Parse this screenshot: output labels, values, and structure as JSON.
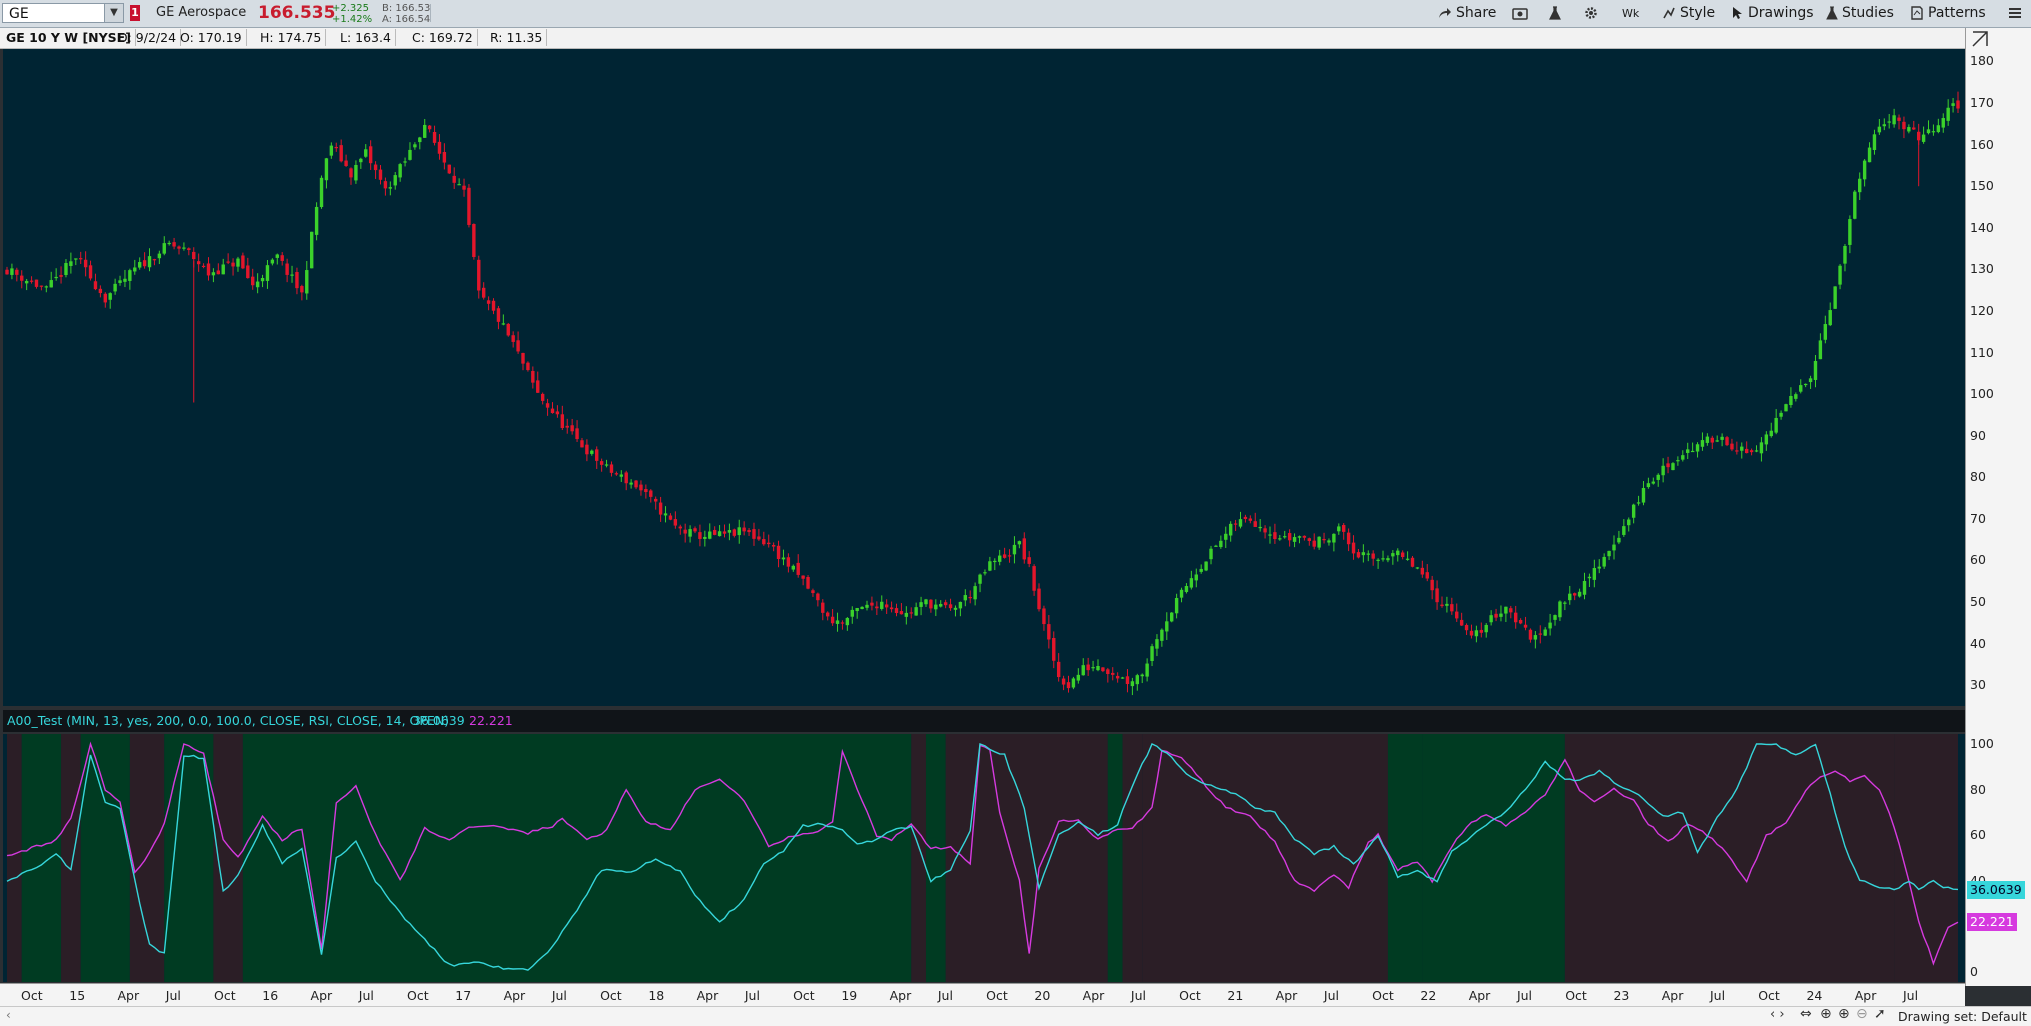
{
  "toolbar": {
    "symbol": "GE",
    "flag": "1",
    "company": "GE Aerospace",
    "last_price": "166.535",
    "change": "+2.325",
    "change_pct": "+1.42%",
    "bid": "B: 166.53",
    "ask": "A: 166.54",
    "buttons": {
      "share": "Share",
      "interval": "Wk",
      "style": "Style",
      "drawings": "Drawings",
      "studies": "Studies",
      "patterns": "Patterns"
    }
  },
  "info_bar": {
    "title": "GE 10 Y W [NYSE]",
    "date": "D: 9/2/24",
    "open": "O: 170.19",
    "high": "H: 174.75",
    "low": "L: 163.4",
    "close": "C: 169.72",
    "range": "R: 11.35"
  },
  "indicator": {
    "label": "A00_Test (MIN, 13, yes, 200, 0.0, 100.0, CLOSE, RSI, CLOSE, 14, OPEN)",
    "value_cyan": "36.0639",
    "value_magenta": "22.221"
  },
  "price_axis": [
    "180",
    "170",
    "160",
    "150",
    "140",
    "130",
    "120",
    "110",
    "100",
    "90",
    "80",
    "70",
    "60",
    "50",
    "40",
    "30"
  ],
  "indicator_axis": [
    "100",
    "80",
    "60",
    "40",
    "20",
    "0"
  ],
  "time_axis": [
    "Oct",
    "15",
    "Apr",
    "Jul",
    "Oct",
    "16",
    "Apr",
    "Jul",
    "Oct",
    "17",
    "Apr",
    "Jul",
    "Oct",
    "18",
    "Apr",
    "Jul",
    "Oct",
    "19",
    "Apr",
    "Jul",
    "Oct",
    "20",
    "Apr",
    "Jul",
    "Oct",
    "21",
    "Apr",
    "Jul",
    "Oct",
    "22",
    "Apr",
    "Jul",
    "Oct",
    "23",
    "Apr",
    "Jul",
    "Oct",
    "24",
    "Apr",
    "Jul"
  ],
  "status": {
    "drawing_set": "Drawing set: Default"
  },
  "colors": {
    "up": "#3bd12b",
    "down": "#e3162b",
    "cyan": "#36d6db",
    "magenta": "#d63adf",
    "background": "#002433",
    "zone_green": "#003b22",
    "zone_dark": "#2b1e26"
  },
  "chart_data": {
    "type": "candlestick",
    "ylim": [
      25,
      183
    ],
    "price_path": [
      [
        0,
        130
      ],
      [
        8,
        125
      ],
      [
        14,
        133
      ],
      [
        20,
        123
      ],
      [
        26,
        130
      ],
      [
        33,
        136
      ],
      [
        37,
        134
      ],
      [
        41,
        129
      ],
      [
        47,
        132
      ],
      [
        50,
        126
      ],
      [
        55,
        133
      ],
      [
        60,
        124
      ],
      [
        64,
        152
      ],
      [
        66,
        160
      ],
      [
        70,
        153
      ],
      [
        73,
        158
      ],
      [
        77,
        149
      ],
      [
        81,
        156
      ],
      [
        85,
        165
      ],
      [
        88,
        158
      ],
      [
        93,
        148
      ],
      [
        96,
        124
      ],
      [
        100,
        118
      ],
      [
        103,
        112
      ],
      [
        108,
        100
      ],
      [
        115,
        90
      ],
      [
        122,
        82
      ],
      [
        128,
        78
      ],
      [
        133,
        72
      ],
      [
        136,
        68
      ],
      [
        140,
        66
      ],
      [
        145,
        66
      ],
      [
        150,
        67
      ],
      [
        155,
        64
      ],
      [
        162,
        55
      ],
      [
        165,
        50
      ],
      [
        167,
        46
      ],
      [
        170,
        45
      ],
      [
        173,
        48
      ],
      [
        178,
        50
      ],
      [
        183,
        47
      ],
      [
        187,
        50
      ],
      [
        192,
        48
      ],
      [
        196,
        52
      ],
      [
        200,
        59
      ],
      [
        204,
        62
      ],
      [
        206,
        64
      ],
      [
        208,
        58
      ],
      [
        211,
        44
      ],
      [
        214,
        32
      ],
      [
        216,
        30
      ],
      [
        219,
        34
      ],
      [
        222,
        35
      ],
      [
        225,
        33
      ],
      [
        228,
        31
      ],
      [
        231,
        33
      ],
      [
        234,
        42
      ],
      [
        238,
        50
      ],
      [
        241,
        56
      ],
      [
        245,
        62
      ],
      [
        250,
        69
      ],
      [
        253,
        70
      ],
      [
        257,
        67
      ],
      [
        260,
        65
      ],
      [
        263,
        66
      ],
      [
        266,
        64
      ],
      [
        269,
        66
      ],
      [
        271,
        68
      ],
      [
        274,
        62
      ],
      [
        278,
        60
      ],
      [
        282,
        62
      ],
      [
        287,
        58
      ],
      [
        291,
        51
      ],
      [
        295,
        47
      ],
      [
        298,
        41
      ],
      [
        302,
        46
      ],
      [
        305,
        49
      ],
      [
        309,
        43
      ],
      [
        311,
        41
      ],
      [
        314,
        46
      ],
      [
        318,
        52
      ],
      [
        321,
        54
      ],
      [
        325,
        61
      ],
      [
        329,
        68
      ],
      [
        333,
        77
      ],
      [
        337,
        82
      ],
      [
        341,
        86
      ],
      [
        345,
        88
      ],
      [
        348,
        90
      ],
      [
        352,
        87
      ],
      [
        355,
        85
      ],
      [
        358,
        90
      ],
      [
        362,
        97
      ],
      [
        367,
        105
      ],
      [
        370,
        117
      ],
      [
        373,
        130
      ],
      [
        376,
        148
      ],
      [
        380,
        162
      ],
      [
        384,
        168
      ],
      [
        386,
        164
      ],
      [
        389,
        162
      ],
      [
        392,
        163
      ],
      [
        394,
        166
      ],
      [
        396,
        170
      ],
      [
        397,
        168
      ]
    ],
    "rsi_path": [
      [
        0,
        51
      ],
      [
        6,
        55
      ],
      [
        10,
        58
      ],
      [
        13,
        67
      ],
      [
        17,
        100
      ],
      [
        20,
        80
      ],
      [
        23,
        74
      ],
      [
        26,
        44
      ],
      [
        29,
        52
      ],
      [
        32,
        65
      ],
      [
        36,
        100
      ],
      [
        40,
        96
      ],
      [
        44,
        58
      ],
      [
        47,
        50
      ],
      [
        52,
        68
      ],
      [
        56,
        58
      ],
      [
        60,
        63
      ],
      [
        64,
        10
      ],
      [
        67,
        74
      ],
      [
        71,
        82
      ],
      [
        75,
        60
      ],
      [
        80,
        40
      ],
      [
        85,
        63
      ],
      [
        90,
        58
      ],
      [
        94,
        63
      ],
      [
        100,
        64
      ],
      [
        106,
        61
      ],
      [
        111,
        64
      ],
      [
        113,
        67
      ],
      [
        118,
        58
      ],
      [
        122,
        62
      ],
      [
        126,
        80
      ],
      [
        130,
        66
      ],
      [
        135,
        62
      ],
      [
        140,
        80
      ],
      [
        145,
        85
      ],
      [
        150,
        75
      ],
      [
        155,
        55
      ],
      [
        160,
        60
      ],
      [
        165,
        61
      ],
      [
        168,
        66
      ],
      [
        170,
        97
      ],
      [
        173,
        80
      ],
      [
        177,
        60
      ],
      [
        180,
        58
      ],
      [
        184,
        65
      ],
      [
        188,
        54
      ],
      [
        192,
        55
      ],
      [
        196,
        47
      ],
      [
        198,
        100
      ],
      [
        200,
        98
      ],
      [
        202,
        70
      ],
      [
        206,
        40
      ],
      [
        208,
        8
      ],
      [
        210,
        45
      ],
      [
        214,
        66
      ],
      [
        218,
        67
      ],
      [
        222,
        58
      ],
      [
        226,
        63
      ],
      [
        229,
        63
      ],
      [
        233,
        72
      ],
      [
        235,
        97
      ],
      [
        239,
        94
      ],
      [
        243,
        84
      ],
      [
        248,
        72
      ],
      [
        253,
        68
      ],
      [
        258,
        57
      ],
      [
        262,
        40
      ],
      [
        266,
        36
      ],
      [
        270,
        43
      ],
      [
        273,
        37
      ],
      [
        277,
        57
      ],
      [
        279,
        60
      ],
      [
        283,
        45
      ],
      [
        287,
        48
      ],
      [
        290,
        40
      ],
      [
        294,
        55
      ],
      [
        297,
        64
      ],
      [
        301,
        69
      ],
      [
        305,
        64
      ],
      [
        309,
        70
      ],
      [
        313,
        78
      ],
      [
        317,
        93
      ],
      [
        320,
        80
      ],
      [
        323,
        75
      ],
      [
        327,
        80
      ],
      [
        331,
        75
      ],
      [
        334,
        65
      ],
      [
        338,
        57
      ],
      [
        342,
        65
      ],
      [
        346,
        60
      ],
      [
        350,
        52
      ],
      [
        354,
        40
      ],
      [
        358,
        60
      ],
      [
        362,
        65
      ],
      [
        366,
        80
      ],
      [
        369,
        85
      ],
      [
        372,
        88
      ],
      [
        375,
        84
      ],
      [
        378,
        86
      ],
      [
        381,
        80
      ],
      [
        384,
        64
      ],
      [
        387,
        40
      ],
      [
        389,
        22
      ],
      [
        392,
        4
      ],
      [
        395,
        20
      ],
      [
        397,
        22
      ]
    ],
    "stoch_path": [
      [
        0,
        40
      ],
      [
        6,
        46
      ],
      [
        10,
        52
      ],
      [
        13,
        45
      ],
      [
        17,
        95
      ],
      [
        20,
        74
      ],
      [
        23,
        72
      ],
      [
        26,
        40
      ],
      [
        29,
        12
      ],
      [
        32,
        8
      ],
      [
        36,
        95
      ],
      [
        40,
        94
      ],
      [
        44,
        35
      ],
      [
        47,
        42
      ],
      [
        52,
        64
      ],
      [
        56,
        48
      ],
      [
        60,
        54
      ],
      [
        64,
        8
      ],
      [
        67,
        50
      ],
      [
        71,
        57
      ],
      [
        75,
        40
      ],
      [
        80,
        26
      ],
      [
        85,
        14
      ],
      [
        90,
        3
      ],
      [
        96,
        4
      ],
      [
        100,
        2
      ],
      [
        106,
        1
      ],
      [
        110,
        8
      ],
      [
        115,
        24
      ],
      [
        121,
        45
      ],
      [
        127,
        44
      ],
      [
        132,
        50
      ],
      [
        137,
        44
      ],
      [
        141,
        31
      ],
      [
        145,
        22
      ],
      [
        150,
        32
      ],
      [
        154,
        48
      ],
      [
        158,
        53
      ],
      [
        162,
        64
      ],
      [
        166,
        65
      ],
      [
        170,
        62
      ],
      [
        173,
        56
      ],
      [
        177,
        58
      ],
      [
        180,
        62
      ],
      [
        184,
        64
      ],
      [
        188,
        40
      ],
      [
        192,
        45
      ],
      [
        196,
        62
      ],
      [
        198,
        100
      ],
      [
        200,
        98
      ],
      [
        203,
        95
      ],
      [
        207,
        72
      ],
      [
        210,
        37
      ],
      [
        214,
        60
      ],
      [
        218,
        66
      ],
      [
        222,
        60
      ],
      [
        226,
        65
      ],
      [
        229,
        82
      ],
      [
        233,
        100
      ],
      [
        237,
        94
      ],
      [
        241,
        85
      ],
      [
        245,
        82
      ],
      [
        250,
        78
      ],
      [
        254,
        72
      ],
      [
        258,
        70
      ],
      [
        262,
        58
      ],
      [
        266,
        52
      ],
      [
        270,
        55
      ],
      [
        274,
        47
      ],
      [
        279,
        60
      ],
      [
        283,
        42
      ],
      [
        287,
        44
      ],
      [
        291,
        40
      ],
      [
        294,
        53
      ],
      [
        297,
        57
      ],
      [
        301,
        65
      ],
      [
        305,
        70
      ],
      [
        309,
        80
      ],
      [
        313,
        92
      ],
      [
        317,
        85
      ],
      [
        320,
        84
      ],
      [
        324,
        88
      ],
      [
        328,
        82
      ],
      [
        333,
        76
      ],
      [
        337,
        68
      ],
      [
        341,
        70
      ],
      [
        344,
        52
      ],
      [
        348,
        68
      ],
      [
        352,
        80
      ],
      [
        356,
        100
      ],
      [
        360,
        100
      ],
      [
        364,
        95
      ],
      [
        368,
        100
      ],
      [
        371,
        78
      ],
      [
        374,
        55
      ],
      [
        377,
        40
      ],
      [
        380,
        38
      ],
      [
        384,
        36
      ],
      [
        387,
        40
      ],
      [
        389,
        36
      ],
      [
        392,
        40
      ],
      [
        394,
        37
      ],
      [
        397,
        36
      ]
    ],
    "zones": [
      [
        0,
        3,
        "d"
      ],
      [
        3,
        11,
        "g"
      ],
      [
        11,
        15,
        "d"
      ],
      [
        15,
        25,
        "g"
      ],
      [
        25,
        32,
        "d"
      ],
      [
        32,
        42,
        "g"
      ],
      [
        42,
        48,
        "d"
      ],
      [
        48,
        184,
        "g"
      ],
      [
        184,
        187,
        "d"
      ],
      [
        187,
        191,
        "g"
      ],
      [
        191,
        224,
        "d"
      ],
      [
        224,
        227,
        "g"
      ],
      [
        227,
        231,
        "d"
      ],
      [
        231,
        281,
        "d"
      ],
      [
        281,
        288,
        "g"
      ],
      [
        288,
        317,
        "g"
      ],
      [
        317,
        384,
        "d"
      ],
      [
        384,
        397,
        "d"
      ]
    ]
  }
}
